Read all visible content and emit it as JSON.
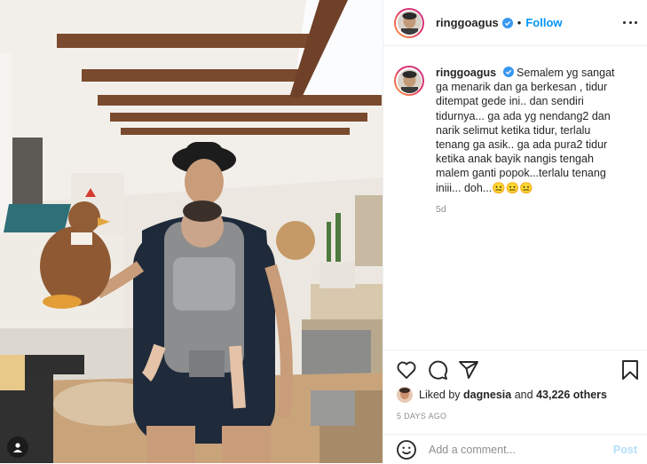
{
  "post": {
    "username": "ringgoagus",
    "follow_label": "Follow",
    "separator": "•",
    "more_icon": "more-horizontal-icon",
    "verified_icon": "verified-badge-icon"
  },
  "caption": {
    "username": "ringgoagus",
    "text": "Semalem yg sangat ga menarik dan ga berkesan , tidur ditempat gede ini.. dan sendiri tidurnya... ga ada yg nendang2 dan narik selimut ketika tidur, terlalu tenang ga asik.. ga ada pura2 tidur ketika anak bayik nangis tengah malem ganti popok...terlalu tenang iniii... doh...😐😐😐",
    "time": "5d"
  },
  "actions": {
    "icons": [
      "heart-icon",
      "comment-icon",
      "share-icon",
      "bookmark-icon"
    ],
    "liked_by_prefix": "Liked by",
    "liked_by_user": "dagnesia",
    "liked_by_and": "and",
    "liked_by_count": "43,226 others",
    "age": "5 DAYS AGO"
  },
  "comment_box": {
    "placeholder": "Add a comment...",
    "post_label": "Post",
    "emoji_icon": "smiley-icon"
  },
  "colors": {
    "accent": "#0095f6",
    "post_disabled": "#b2dffc",
    "muted": "#8e8e8e",
    "text": "#262626"
  }
}
